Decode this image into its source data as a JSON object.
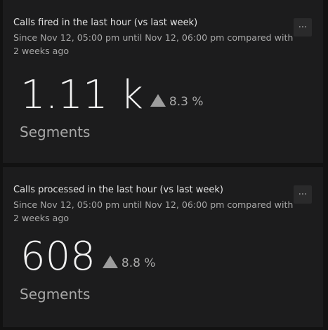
{
  "cards": [
    {
      "title": "Calls fired in the last hour (vs last week)",
      "subtitle": "Since Nov 12, 05:00 pm until Nov 12, 06:00 pm compared with 2 weeks ago",
      "value": "1.11 k",
      "change": "8.3 %",
      "change_direction": "up",
      "unit": "Segments",
      "menu_label": "···"
    },
    {
      "title": "Calls processed in the last hour (vs last week)",
      "subtitle": "Since Nov 12, 05:00 pm until Nov 12, 06:00 pm compared with 2 weeks ago",
      "value": "608",
      "change": "8.8 %",
      "change_direction": "up",
      "unit": "Segments",
      "menu_label": "···"
    }
  ],
  "colors": {
    "background": "#121212",
    "card": "#1c1c1d",
    "text_primary": "#f2f2f2",
    "text_secondary": "#a8a8a8",
    "indicator": "#9d9d9d"
  },
  "icons": {
    "menu": "ellipsis-icon",
    "trend": "triangle-up-icon"
  }
}
